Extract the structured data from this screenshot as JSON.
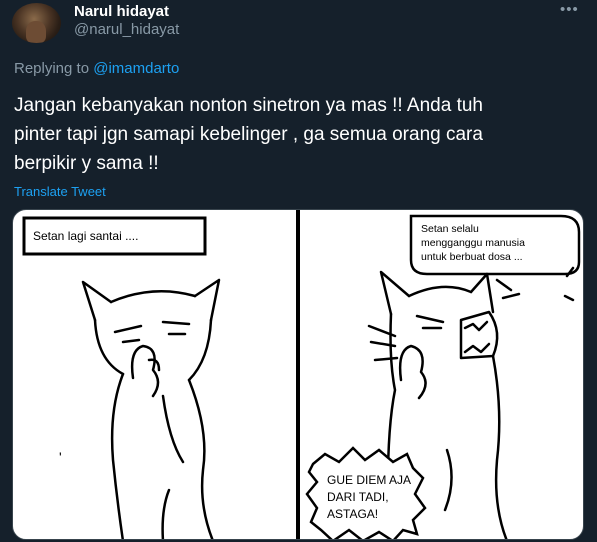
{
  "author": {
    "display_name": "Narul hidayat",
    "handle": "@narul_hidayat",
    "avatar_icon": "profile-photo"
  },
  "more_icon": "more-options-icon",
  "reply": {
    "prefix": "Replying to",
    "mention": "@imamdarto"
  },
  "tweet": {
    "lines": [
      "Jangan kebanyakan nonton sinetron ya mas !! Anda tuh",
      "pinter tapi jgn samapi kebelinger , ga semua orang cara",
      "berpikir y sama !!"
    ],
    "translate_label": "Translate Tweet"
  },
  "comic": {
    "left_panel": {
      "caption": "Setan lagi santai ...."
    },
    "right_panel": {
      "speech_lines": [
        "Setan selalu",
        "mengganggu manusia",
        "untuk berbuat dosa ..."
      ],
      "shout_lines": [
        "GUE DIEM AJA",
        "DARI TADI,",
        "ASTAGA!"
      ]
    }
  },
  "colors": {
    "background": "#15202b",
    "text_primary": "#ffffff",
    "text_secondary": "#8899a6",
    "accent": "#1da1f2"
  }
}
